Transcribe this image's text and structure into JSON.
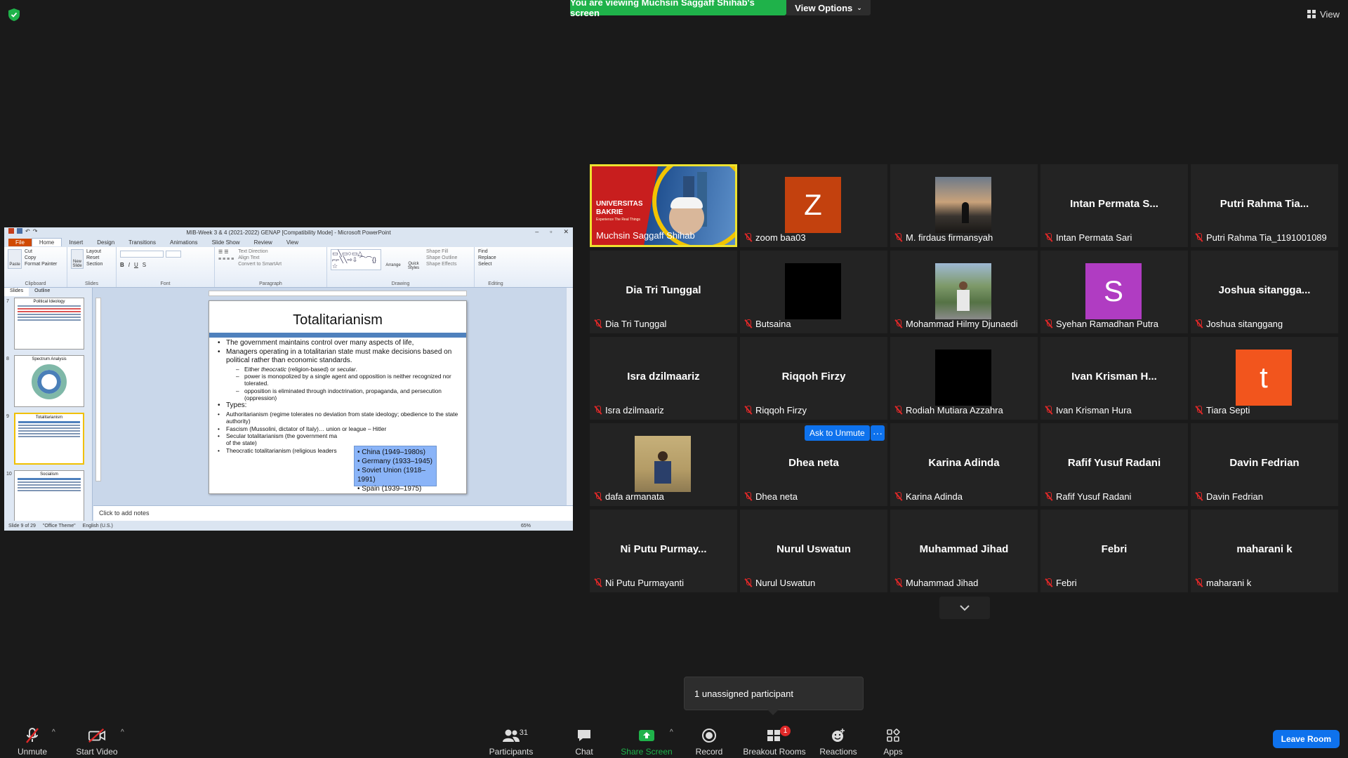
{
  "banner": {
    "viewing_text": "You are viewing Muchsin Saggaff Shihab's screen",
    "view_options_label": "View Options",
    "view_label": "View"
  },
  "shared_screen": {
    "window_title": "MIB-Week 3 & 4  (2021-2022) GENAP [Compatibility Mode] - Microsoft PowerPoint",
    "ribbon_tabs": [
      "File",
      "Home",
      "Insert",
      "Design",
      "Transitions",
      "Animations",
      "Slide Show",
      "Review",
      "View"
    ],
    "ribbon_groups": {
      "clipboard": {
        "label": "Clipboard",
        "items": [
          "Cut",
          "Copy",
          "Format Painter"
        ],
        "paste": "Paste"
      },
      "slides": {
        "label": "Slides",
        "items": [
          "Layout",
          "Reset",
          "Section"
        ],
        "new_slide": "New Slide"
      },
      "font": {
        "label": "Font"
      },
      "paragraph": {
        "label": "Paragraph",
        "items": [
          "Text Direction",
          "Align Text",
          "Convert to SmartArt"
        ]
      },
      "drawing": {
        "label": "Drawing",
        "items": [
          "Shape Fill",
          "Shape Outline",
          "Shape Effects"
        ],
        "arrange": "Arrange",
        "quick_styles": "Quick Styles"
      },
      "editing": {
        "label": "Editing",
        "items": [
          "Find",
          "Replace",
          "Select"
        ]
      }
    },
    "side_tabs": [
      "Slides",
      "Outline"
    ],
    "thumbnails": [
      {
        "num": "7",
        "title": "Political Ideology"
      },
      {
        "num": "8",
        "title": "Spectrum Analysis"
      },
      {
        "num": "9",
        "title": "Totalitarianism"
      },
      {
        "num": "10",
        "title": "Socialism"
      }
    ],
    "slide": {
      "title": "Totalitarianism",
      "bullets": [
        "The government maintains control over many aspects of life,",
        "Managers operating in a totalitarian state must make decisions based on political rather than economic standards."
      ],
      "sub_bullets": [
        {
          "pre": "Either ",
          "em1": "theocratic",
          "mid": " (religion-based) or ",
          "em2": "secular",
          "post": "."
        },
        {
          "text": "power is monopolized by a single agent and opposition is neither recognized nor tolerated."
        },
        {
          "text": "opposition is eliminated through indoctrination, propaganda, and persecution (oppression)"
        }
      ],
      "types_label": "Types:",
      "types": [
        "Authoritarianism (regime tolerates no deviation from state ideology; obedience to the state authority)",
        "Fascism (Mussolini, dictator of Italy)… union or league – Hitler",
        "Secular totalitarianism (the government ma",
        "of the state)",
        "Theocratic totalitarianism (religious leaders"
      ],
      "popup": [
        "China (1949–1980s)",
        "Germany (1933–1945)",
        "Soviet Union (1918–1991)",
        "Spain (1939–1975)"
      ]
    },
    "notes_placeholder": "Click to add notes",
    "status": {
      "slide": "Slide 9 of 29",
      "theme": "\"Office Theme\"",
      "lang": "English (U.S.)",
      "zoom": "65%"
    }
  },
  "tiles": [
    {
      "name": "Muchsin Saggaff Shihab",
      "display": "",
      "kind": "video",
      "muted": false,
      "active": true
    },
    {
      "name": "zoom baa03",
      "display": "Z",
      "kind": "avatar",
      "color": "#c3410e",
      "muted": true
    },
    {
      "name": "M. firdaus firmansyah",
      "display": "",
      "kind": "photo-sunset",
      "muted": true
    },
    {
      "name": "Intan Permata Sari",
      "display": "Intan Permata S...",
      "kind": "text",
      "muted": true
    },
    {
      "name": "Putri Rahma Tia_1191001089",
      "display": "Putri Rahma Tia...",
      "kind": "text",
      "muted": true
    },
    {
      "name": "Dia Tri Tunggal",
      "display": "Dia Tri Tunggal",
      "kind": "text",
      "muted": true
    },
    {
      "name": "Butsaina",
      "display": "",
      "kind": "black",
      "muted": true
    },
    {
      "name": "Mohammad Hilmy Djunaedi",
      "display": "",
      "kind": "photo-person",
      "muted": true
    },
    {
      "name": "Syehan Ramadhan Putra",
      "display": "S",
      "kind": "avatar",
      "color": "#b03cc2",
      "muted": true
    },
    {
      "name": "Joshua sitanggang",
      "display": "Joshua sitangga...",
      "kind": "text",
      "muted": true
    },
    {
      "name": "Isra dzilmaariz",
      "display": "Isra dzilmaariz",
      "kind": "text",
      "muted": true
    },
    {
      "name": "Riqqoh Firzy",
      "display": "Riqqoh Firzy",
      "kind": "text",
      "muted": true
    },
    {
      "name": "Rodiah Mutiara Azzahra",
      "display": "",
      "kind": "black",
      "muted": true
    },
    {
      "name": "Ivan Krisman Hura",
      "display": "Ivan Krisman H...",
      "kind": "text",
      "muted": true
    },
    {
      "name": "Tiara Septi",
      "display": "t",
      "kind": "avatar",
      "color": "#f2551d",
      "muted": true
    },
    {
      "name": "dafa armanata",
      "display": "",
      "kind": "photo-room",
      "muted": true
    },
    {
      "name": "Dhea neta",
      "display": "Dhea neta",
      "kind": "text",
      "muted": true
    },
    {
      "name": "Karina Adinda",
      "display": "Karina Adinda",
      "kind": "text",
      "muted": true
    },
    {
      "name": "Rafif Yusuf Radani",
      "display": "Rafif Yusuf Radani",
      "kind": "text",
      "muted": true
    },
    {
      "name": "Davin Fedrian",
      "display": "Davin Fedrian",
      "kind": "text",
      "muted": true
    },
    {
      "name": "Ni Putu Purmayanti",
      "display": "Ni Putu Purmay...",
      "kind": "text",
      "muted": true
    },
    {
      "name": "Nurul Uswatun",
      "display": "Nurul Uswatun",
      "kind": "text",
      "muted": true
    },
    {
      "name": "Muhammad Jihad",
      "display": "Muhammad Jihad",
      "kind": "text",
      "muted": true
    },
    {
      "name": "Febri",
      "display": "Febri",
      "kind": "text",
      "muted": true
    },
    {
      "name": "maharani k",
      "display": "maharani k",
      "kind": "text",
      "muted": true
    }
  ],
  "active_video_banner": {
    "line1": "UNIVERSITAS",
    "line2": "BAKRIE",
    "tagline": "Experience The Real Things"
  },
  "ask_to_unmute_label": "Ask to Unmute",
  "more_label": "···",
  "unassigned_text": "1 unassigned participant",
  "toolbar": {
    "unmute": "Unmute",
    "start_video": "Start Video",
    "participants": "Participants",
    "participants_count": "31",
    "chat": "Chat",
    "share_screen": "Share Screen",
    "record": "Record",
    "breakout_rooms": "Breakout Rooms",
    "breakout_badge": "1",
    "reactions": "Reactions",
    "apps": "Apps",
    "leave_room": "Leave Room"
  },
  "colors": {
    "accent_green": "#1fb24a",
    "accent_blue": "#0e72ed",
    "active_border": "#ede22f",
    "muted_red": "#e02828"
  }
}
